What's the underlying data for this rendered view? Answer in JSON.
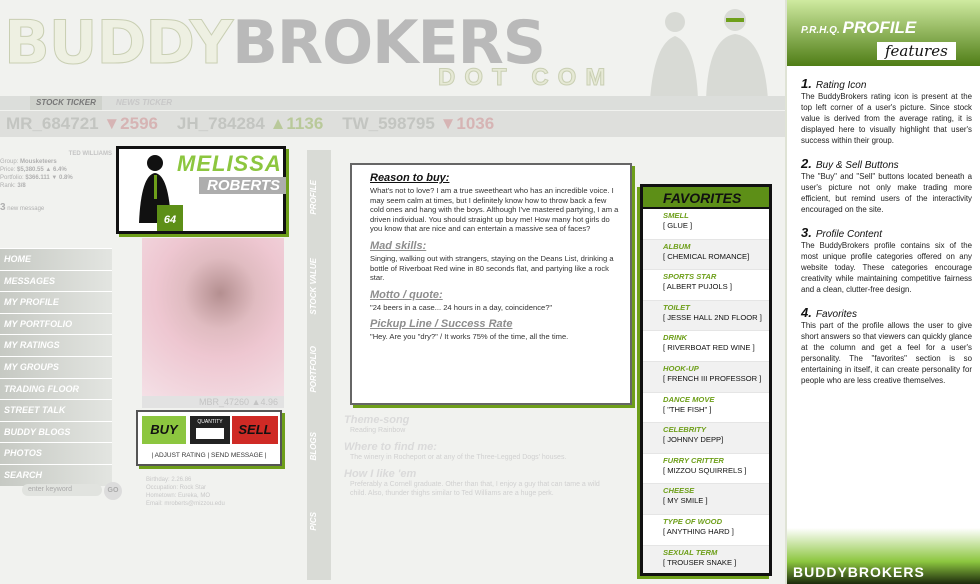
{
  "brand": {
    "logo_part1": "BUDDY",
    "logo_part2": "BROKERS",
    "logo_sub": "DOT COM"
  },
  "ticker_tabs": {
    "active": "STOCK TICKER",
    "inactive": "NEWS TICKER"
  },
  "ticker": [
    {
      "sym": "MR_684721",
      "chg": "▼2596",
      "dir": "dn"
    },
    {
      "sym": "JH_784284",
      "chg": "▲1136",
      "dir": "up"
    },
    {
      "sym": "TW_598795",
      "chg": "▼1036",
      "dir": "dn"
    }
  ],
  "member": {
    "name": "TED WILLIAMS",
    "group_label": "Group:",
    "group": "Mousketeers",
    "price_label": "Price:",
    "price": "$5,380.55 ▲ 6.4%",
    "portfolio_label": "Portfolio:",
    "portfolio": "$366.111 ▼ 0.8%",
    "rank_label": "Rank:",
    "rank": "3/8",
    "msg_count": "3",
    "msg_label": "new message"
  },
  "nav": {
    "items": [
      "HOME",
      "MESSAGES",
      "MY PROFILE",
      "MY PORTFOLIO",
      "MY RATINGS",
      "MY GROUPS",
      "TRADING FLOOR",
      "STREET TALK",
      "BUDDY BLOGS",
      "PHOTOS",
      "SEARCH"
    ],
    "search_placeholder": "enter keyword",
    "go": "GO"
  },
  "side_tabs": [
    "PROFILE",
    "STOCK VALUE",
    "PORTFOLIO",
    "BLOGS",
    "PICS"
  ],
  "profile": {
    "first": "MELISSA",
    "last": "ROBERTS",
    "rating": "64",
    "mbr": "MBR_47260 ▲4.96"
  },
  "trade": {
    "buy": "BUY",
    "sell": "SELL",
    "quantity": "QUANTITY",
    "adjust": "| ADJUST RATING",
    "send": "| SEND MESSAGE |"
  },
  "content": [
    {
      "title": "Reason to buy:",
      "text": "What's not to love? I am a true sweetheart who has an incredible voice. I may seem calm at times, but I definitely know how to throw back a few cold ones and hang with the boys. Although I've mastered partying, I am a driven individual. You should straight up buy me! How many hot girls do you know that are nice and can entertain a massive sea of faces?"
    },
    {
      "title": "Mad skills:",
      "text": "Singing, walking out with strangers, staying on the Deans List, drinking a bottle of Riverboat Red wine in 80 seconds flat, and partying like a rock star."
    },
    {
      "title": "Motto / quote:",
      "text": "\"24 beers in a case... 24 hours in a day, coincidence?\""
    },
    {
      "title": "Pickup Line / Success Rate",
      "text": "\"Hey. Are you \"dry?\" / It works 75% of the time, all the time."
    }
  ],
  "faded": [
    {
      "title": "Theme-song",
      "text": "Reading Rainbow"
    },
    {
      "title": "Where to find me:",
      "text": "The winery in Rocheport or at any of the Three-Legged Dogs' houses."
    },
    {
      "title": "How I like 'em",
      "text": "Preferably a Cornell graduate. Other than that, I enjoy a guy that can tame a wild child. Also, thunder thighs similar to Ted Williams are a huge perk."
    }
  ],
  "extra_info": [
    "Birthday: 2.26.86",
    "Occupation: Rock Star",
    "Hometown: Eureka, MO",
    "Email: mroberts@mizzou.edu"
  ],
  "favorites": {
    "title": "FAVORITES",
    "items": [
      {
        "k": "SMELL",
        "v": "[ GLUE ]"
      },
      {
        "k": "ALBUM",
        "v": "[ CHEMICAL ROMANCE]"
      },
      {
        "k": "SPORTS STAR",
        "v": "[ ALBERT PUJOLS ]"
      },
      {
        "k": "TOILET",
        "v": "[ JESSE HALL 2ND FLOOR ]"
      },
      {
        "k": "DRINK",
        "v": "[ RIVERBOAT RED WINE ]"
      },
      {
        "k": "HOOK-UP",
        "v": "[ FRENCH III PROFESSOR ]"
      },
      {
        "k": "DANCE MOVE",
        "v": "[ \"THE FISH\" ]"
      },
      {
        "k": "CELEBRITY",
        "v": "[ JOHNNY DEPP]"
      },
      {
        "k": "FURRY CRITTER",
        "v": "[ MIZZOU SQUIRRELS ]"
      },
      {
        "k": "CHEESE",
        "v": "[ MY SMILE ]"
      },
      {
        "k": "TYPE OF WOOD",
        "v": "[ ANYTHING HARD ]"
      },
      {
        "k": "SEXUAL TERM",
        "v": "[ TROUSER SNAKE ]"
      }
    ]
  },
  "features": {
    "kicker": "P.R.H.Q.",
    "title": "PROFILE",
    "subtitle": "features",
    "sections": [
      {
        "n": "1.",
        "h": "Rating Icon",
        "p": "The BuddyBrokers rating icon is present at the top left corner of a user's picture. Since stock value is derived from the average rating, it is displayed here to visually highlight that user's success within their group."
      },
      {
        "n": "2.",
        "h": "Buy & Sell Buttons",
        "p": "The \"Buy\" and \"Sell\" buttons located beneath a user's picture not only make trading more efficient, but remind users of the interactivity encouraged on the site."
      },
      {
        "n": "3.",
        "h": "Profile Content",
        "p": "The BuddyBrokers profile contains six of the most unique profile categories offered on any website today. These categories encourage creativity while maintaining competitive fairness and a clean, clutter-free design."
      },
      {
        "n": "4.",
        "h": "Favorites",
        "p": "This part of the profile allows the user to give short answers so that viewers can quickly glance at the column and get a feel for a user's personality. The \"favorites\" section is so entertaining in itself, it can create personality for people who are less creative themselves."
      }
    ],
    "footer": "BUDDYBROKERS"
  }
}
